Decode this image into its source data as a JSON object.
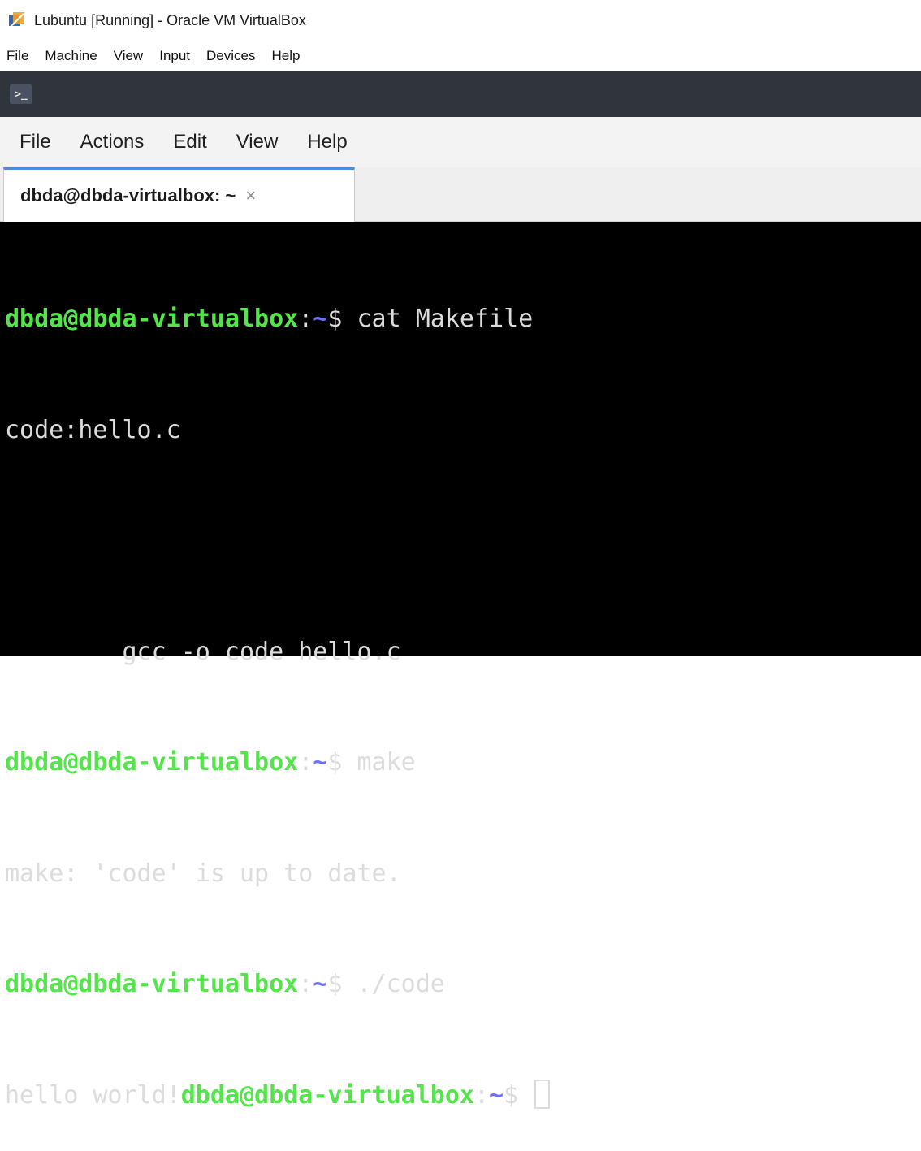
{
  "window": {
    "title": "Lubuntu [Running] - Oracle VM VirtualBox",
    "icon": "virtualbox-logo"
  },
  "host_menu": [
    "File",
    "Machine",
    "View",
    "Input",
    "Devices",
    "Help"
  ],
  "guest_panel": {
    "app_icon": "terminal-icon",
    "app_icon_glyph": ">_"
  },
  "terminal_menu": [
    "File",
    "Actions",
    "Edit",
    "View",
    "Help"
  ],
  "tab": {
    "label": "dbda@dbda-virtualbox: ~",
    "close_glyph": "×"
  },
  "terminal": {
    "user_host": "dbda@dbda-virtualbox",
    "colon": ":",
    "tilde": "~",
    "dollar": "$",
    "lines": [
      {
        "type": "prompt",
        "command": " cat Makefile"
      },
      {
        "type": "output",
        "text": "code:hello.c"
      },
      {
        "type": "output",
        "text": ""
      },
      {
        "type": "output",
        "text": "        gcc -o code hello.c"
      },
      {
        "type": "prompt",
        "command": " make"
      },
      {
        "type": "output",
        "text": "make: 'code' is up to date."
      },
      {
        "type": "prompt",
        "command": " ./code"
      },
      {
        "type": "output-then-prompt",
        "text": "hello world!",
        "command": " "
      }
    ]
  },
  "colors": {
    "user_host": "#54e54b",
    "path": "#6f6ffc",
    "text": "#dcdcdc",
    "background": "#000000",
    "guest_panel": "#2f343d",
    "tab_accent": "#4a90d9"
  }
}
